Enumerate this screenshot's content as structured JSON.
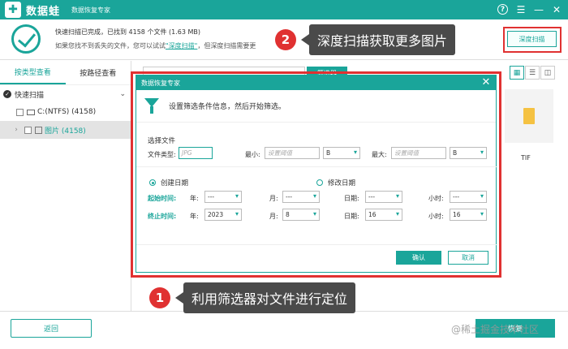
{
  "titlebar": {
    "brand": "数据蛙",
    "app_title": "数据恢复专家",
    "logo_glyph": "✚",
    "help_glyph": "?",
    "menu_glyph": "☰",
    "min_glyph": "—",
    "close_glyph": "✕"
  },
  "status": {
    "line1": "快速扫描已完成，已找到 4158 个文件 (1.63 MB)",
    "line2_prefix": "如果您找不到丢失的文件，您可以试试",
    "line2_link": "\"深度扫描\"",
    "line2_suffix": "，但深度扫描需要更"
  },
  "deep_scan_button": "深度扫描",
  "annotations": {
    "a2_num": "2",
    "a2_text": "深度扫描获取更多图片",
    "a1_num": "1",
    "a1_text": "利用筛选器对文件进行定位"
  },
  "left_panel": {
    "tabs": [
      "按类型查看",
      "按路径查看"
    ],
    "quick_scan": "快速扫描",
    "drive": "C:(NTFS) (4158)",
    "images": "图片 (4158)"
  },
  "toolbar": {
    "filter_label": "筛选器",
    "view_icons": [
      "grid-icon",
      "list-icon",
      "detail-icon"
    ]
  },
  "files": [
    {
      "label": "TIF"
    }
  ],
  "dialog": {
    "title": "数据恢复专家",
    "close_glyph": "✕",
    "description": "设置筛选条件信息，然后开始筛选。",
    "section_file": "选择文件",
    "file_type_label": "文件类型:",
    "file_type_placeholder": "JPG",
    "min_label": "最小:",
    "min_placeholder": "设置阈值",
    "min_unit": "B",
    "max_label": "最大:",
    "max_placeholder": "设置阈值",
    "max_unit": "B",
    "radio_created": "创建日期",
    "radio_modified": "修改日期",
    "start_label": "起始时间:",
    "end_label": "终止时间:",
    "year_label": "年:",
    "month_label": "月:",
    "day_label": "日期:",
    "hour_label": "小时:",
    "start": {
      "year": "---",
      "month": "---",
      "day": "---",
      "hour": "---"
    },
    "end": {
      "year": "2023",
      "month": "8",
      "day": "16",
      "hour": "16"
    },
    "ok": "确认",
    "cancel": "取消"
  },
  "bottom": {
    "back": "返回",
    "recover": "恢复"
  },
  "watermark": "@稀土掘金技术社区"
}
